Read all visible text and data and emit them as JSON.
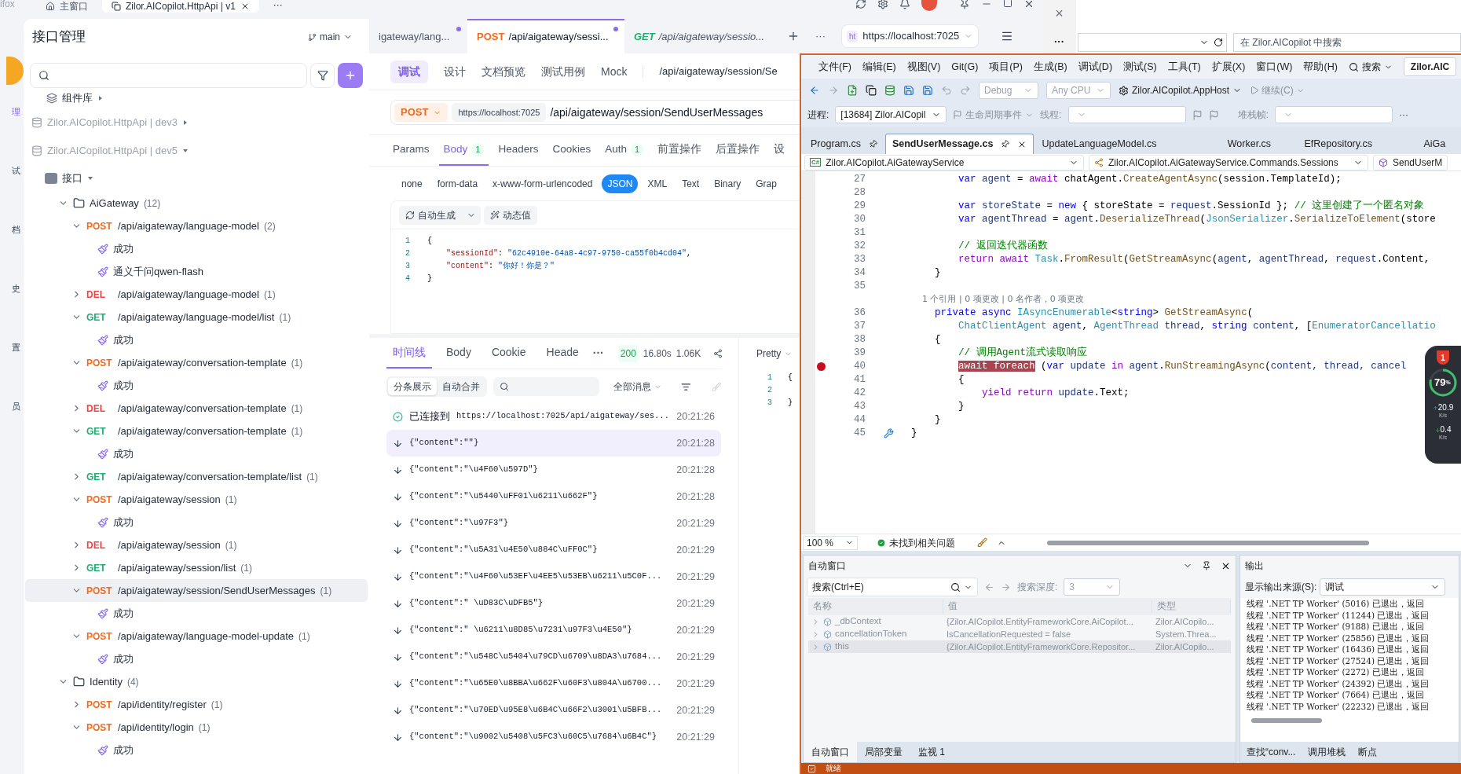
{
  "explorer": {
    "close": "×",
    "more": "···",
    "search_placeholder": "在 Zilor.AICopilot 中搜索"
  },
  "apifox": {
    "titlebar": {
      "app_name": "ifox",
      "tabs": [
        {
          "label": "主窗口",
          "selected": false
        },
        {
          "label": "Zilor.AICopilot.HttpApi | v1",
          "selected": true
        }
      ],
      "more": "···"
    },
    "nav": [
      {
        "label": "理",
        "selected": true
      },
      {
        "label": "试",
        "selected": false
      },
      {
        "label": "档",
        "selected": false
      },
      {
        "label": "史",
        "selected": false
      },
      {
        "label": "置",
        "selected": false
      },
      {
        "label": "员",
        "selected": false
      }
    ],
    "panel": {
      "title": "接口管理",
      "branch": "main"
    },
    "tree": [
      {
        "kind": "library",
        "label": "组件库",
        "expanded": false
      },
      {
        "kind": "project",
        "label": "Zilor.AICopilot.HttpApi | dev3",
        "expanded": false
      },
      {
        "kind": "project",
        "label": "Zilor.AICopilot.HttpApi | dev5",
        "expanded": true,
        "children": [
          {
            "kind": "root",
            "label": "接口",
            "expanded": true,
            "children": [
              {
                "kind": "folder",
                "label": "AiGateway",
                "count": "(12)",
                "expanded": true,
                "children": [
                  {
                    "kind": "endpoint",
                    "method": "POST",
                    "color": "#f26b1d",
                    "path": "/api/aigateway/language-model",
                    "count": "(2)",
                    "expanded": true,
                    "selected": false,
                    "children": [
                      {
                        "kind": "case",
                        "label": "成功",
                        "selected": false
                      },
                      {
                        "kind": "case",
                        "label": "通义千问qwen-flash",
                        "selected": false
                      }
                    ]
                  },
                  {
                    "kind": "endpoint",
                    "method": "DEL",
                    "color": "#ef4444",
                    "path": "/api/aigateway/language-model",
                    "count": "(1)",
                    "expanded": false,
                    "selected": false
                  },
                  {
                    "kind": "endpoint",
                    "method": "GET",
                    "color": "#1fae72",
                    "path": "/api/aigateway/language-model/list",
                    "count": "(1)",
                    "expanded": true,
                    "selected": false,
                    "children": [
                      {
                        "kind": "case",
                        "label": "成功",
                        "selected": false
                      }
                    ]
                  },
                  {
                    "kind": "endpoint",
                    "method": "POST",
                    "color": "#f26b1d",
                    "path": "/api/aigateway/conversation-template",
                    "count": "(1)",
                    "expanded": true,
                    "selected": false,
                    "children": [
                      {
                        "kind": "case",
                        "label": "成功",
                        "selected": false
                      }
                    ]
                  },
                  {
                    "kind": "endpoint",
                    "method": "DEL",
                    "color": "#ef4444",
                    "path": "/api/aigateway/conversation-template",
                    "count": "(1)",
                    "expanded": false,
                    "selected": false
                  },
                  {
                    "kind": "endpoint",
                    "method": "GET",
                    "color": "#1fae72",
                    "path": "/api/aigateway/conversation-template",
                    "count": "(1)",
                    "expanded": true,
                    "selected": false,
                    "children": [
                      {
                        "kind": "case",
                        "label": "成功",
                        "selected": false
                      }
                    ]
                  },
                  {
                    "kind": "endpoint",
                    "method": "GET",
                    "color": "#1fae72",
                    "path": "/api/aigateway/conversation-template/list",
                    "count": "(1)",
                    "expanded": false,
                    "selected": false
                  },
                  {
                    "kind": "endpoint",
                    "method": "POST",
                    "color": "#f26b1d",
                    "path": "/api/aigateway/session",
                    "count": "(1)",
                    "expanded": true,
                    "selected": false,
                    "children": [
                      {
                        "kind": "case",
                        "label": "成功",
                        "selected": false
                      }
                    ]
                  },
                  {
                    "kind": "endpoint",
                    "method": "DEL",
                    "color": "#ef4444",
                    "path": "/api/aigateway/session",
                    "count": "(1)",
                    "expanded": false,
                    "selected": false
                  },
                  {
                    "kind": "endpoint",
                    "method": "GET",
                    "color": "#1fae72",
                    "path": "/api/aigateway/session/list",
                    "count": "(1)",
                    "expanded": false,
                    "selected": false
                  },
                  {
                    "kind": "endpoint",
                    "method": "POST",
                    "color": "#f26b1d",
                    "path": "/api/aigateway/session/SendUserMessages",
                    "count": "(1)",
                    "expanded": true,
                    "selected": true,
                    "children": [
                      {
                        "kind": "case",
                        "label": "成功",
                        "selected": false
                      }
                    ]
                  },
                  {
                    "kind": "endpoint",
                    "method": "POST",
                    "color": "#f26b1d",
                    "path": "/api/aigateway/language-model-update",
                    "count": "(1)",
                    "expanded": true,
                    "selected": false,
                    "children": [
                      {
                        "kind": "case",
                        "label": "成功",
                        "selected": false
                      }
                    ]
                  }
                ]
              },
              {
                "kind": "folder",
                "label": "Identity",
                "count": "(4)",
                "expanded": true,
                "children": [
                  {
                    "kind": "endpoint",
                    "method": "POST",
                    "color": "#f26b1d",
                    "path": "/api/identity/register",
                    "count": "(1)",
                    "expanded": false,
                    "selected": false
                  },
                  {
                    "kind": "endpoint",
                    "method": "POST",
                    "color": "#f26b1d",
                    "path": "/api/identity/login",
                    "count": "(1)",
                    "expanded": true,
                    "selected": false,
                    "children": [
                      {
                        "kind": "case",
                        "label": "成功",
                        "selected": false
                      }
                    ]
                  }
                ]
              }
            ]
          }
        ]
      }
    ],
    "request_tabs": [
      {
        "label": "igateway/lang...",
        "dirty": true,
        "selected": false
      },
      {
        "method": "POST",
        "color": "#f26b1d",
        "label": "/api/aigateway/sessi...",
        "dirty": true,
        "selected": true
      },
      {
        "method": "GET",
        "color": "#1fae72",
        "label": "/api/aigateway/sessio...",
        "dirty": false,
        "selected": false
      }
    ],
    "tab_more": "···",
    "env": {
      "badge": "ht",
      "url": "https://localhost:7025"
    },
    "mode_tabs": [
      {
        "label": "调试",
        "selected": true
      },
      {
        "label": "设计",
        "selected": false
      },
      {
        "label": "文档预览",
        "selected": false
      },
      {
        "label": "测试用例",
        "selected": false
      },
      {
        "label": "Mock",
        "selected": false
      }
    ],
    "path_title": "/api/aigateway/session/Se",
    "request": {
      "method": "POST",
      "color": "#f26b1d",
      "base_url": "https://localhost:7025",
      "path": "/api/aigateway/session/SendUserMessages"
    },
    "param_tabs": [
      {
        "label": "Params",
        "selected": false
      },
      {
        "label": "Body",
        "count": "1",
        "selected": true
      },
      {
        "label": "Headers",
        "selected": false
      },
      {
        "label": "Cookies",
        "selected": false
      },
      {
        "label": "Auth",
        "count": "1",
        "selected": false
      },
      {
        "label": "前置操作",
        "selected": false
      },
      {
        "label": "后置操作",
        "selected": false
      },
      {
        "label": "设",
        "selected": false
      }
    ],
    "body_types": [
      {
        "label": "none",
        "selected": false
      },
      {
        "label": "form-data",
        "selected": false
      },
      {
        "label": "x-www-form-urlencoded",
        "selected": false
      },
      {
        "label": "JSON",
        "selected": true
      },
      {
        "label": "XML",
        "selected": false
      },
      {
        "label": "Text",
        "selected": false
      },
      {
        "label": "Binary",
        "selected": false
      },
      {
        "label": "Grap",
        "selected": false
      }
    ],
    "editor_tools": {
      "generate": "自动生成",
      "dynamic": "动态值"
    },
    "body_lines": [
      {
        "number": "1",
        "tokens": [
          {
            "kind": "punct",
            "text": "{"
          }
        ]
      },
      {
        "number": "2",
        "tokens": [
          {
            "kind": "key",
            "text": "    \"sessionId\""
          },
          {
            "kind": "punct",
            "text": ": "
          },
          {
            "kind": "string",
            "text": "\"62c4910e-64a8-4c97-9750-ca55f0b4cd04\""
          },
          {
            "kind": "punct",
            "text": ","
          }
        ]
      },
      {
        "number": "3",
        "tokens": [
          {
            "kind": "key",
            "text": "    \"content\""
          },
          {
            "kind": "punct",
            "text": ": "
          },
          {
            "kind": "string",
            "text": "\"你好！你是？\""
          }
        ]
      },
      {
        "number": "4",
        "tokens": [
          {
            "kind": "punct",
            "text": "}"
          }
        ]
      }
    ],
    "response": {
      "tabs": [
        {
          "label": "时间线",
          "selected": true
        },
        {
          "label": "Body",
          "selected": false
        },
        {
          "label": "Cookie",
          "selected": false
        },
        {
          "label": "Heade",
          "selected": false
        }
      ],
      "more": "···",
      "status": "200",
      "duration": "16.80s",
      "size": "1.06K",
      "view": "Pretty",
      "preview_lines": [
        {
          "number": "1",
          "text": "{"
        },
        {
          "number": "2"
        },
        {
          "number": "3",
          "text": "}"
        }
      ],
      "modes": [
        {
          "label": "分条展示",
          "selected": true
        },
        {
          "label": "自动合并",
          "selected": false
        }
      ],
      "filter": "全部消息",
      "timeline": [
        {
          "kind": "connected",
          "label": "已连接到",
          "text": "https://localhost:7025/api/aigateway/ses...",
          "time": "20:21:26",
          "selected": false
        },
        {
          "kind": "message",
          "text": "{\"content\":\"\"}",
          "time": "20:21:28",
          "selected": true
        },
        {
          "kind": "message",
          "text": "{\"content\":\"\\u4F60\\u597D\"}",
          "time": "20:21:28",
          "selected": false
        },
        {
          "kind": "message",
          "text": "{\"content\":\"\\u5440\\uFF01\\u6211\\u662F\"}",
          "time": "20:21:28",
          "selected": false
        },
        {
          "kind": "message",
          "text": "{\"content\":\"\\u97F3\"}",
          "time": "20:21:29",
          "selected": false
        },
        {
          "kind": "message",
          "text": "{\"content\":\"\\u5A31\\u4E50\\u884C\\uFF0C\"}",
          "time": "20:21:29",
          "selected": false
        },
        {
          "kind": "message",
          "text": "{\"content\":\"\\u4F60\\u53EF\\u4EE5\\u53EB\\u6211\\u5C0F...",
          "time": "20:21:29",
          "selected": false
        },
        {
          "kind": "message",
          "text": "{\"content\":\" \\uD83C\\uDFB5\"}",
          "time": "20:21:29",
          "selected": false
        },
        {
          "kind": "message",
          "text": "{\"content\":\" \\u6211\\u8D85\\u7231\\u97F3\\u4E50\"}",
          "time": "20:21:29",
          "selected": false
        },
        {
          "kind": "message",
          "text": "{\"content\":\"\\u548C\\u5404\\u79CD\\u6709\\u8DA3\\u7684...",
          "time": "20:21:29",
          "selected": false
        },
        {
          "kind": "message",
          "text": "{\"content\":\"\\u65E0\\u8BBA\\u662F\\u60F3\\u804A\\u6700...",
          "time": "20:21:29",
          "selected": false
        },
        {
          "kind": "message",
          "text": "{\"content\":\"\\u70ED\\u95E8\\u6B4C\\u66F2\\u3001\\u5BFB...",
          "time": "20:21:29",
          "selected": false
        },
        {
          "kind": "message",
          "text": "{\"content\":\"\\u9002\\u5408\\u5FC3\\u60C5\\u7684\\u6B4C\"}",
          "time": "20:21:29",
          "selected": false
        }
      ]
    }
  },
  "vs": {
    "menu": [
      "文件(F)",
      "编辑(E)",
      "视图(V)",
      "Git(G)",
      "项目(P)",
      "生成(B)",
      "调试(D)",
      "测试(S)",
      "工具(T)",
      "扩展(X)",
      "窗口(W)",
      "帮助(H)"
    ],
    "search": "搜索",
    "title": "Zilor.AIC",
    "toolbar": {
      "config": "Debug",
      "platform": "Any CPU",
      "startup": "Zilor.AICopilot.AppHost",
      "continue": "继续(C)"
    },
    "debug_bar": {
      "process_label": "进程:",
      "process": "[13684] Zilor.AICopil",
      "lifecycle": "生命周期事件",
      "thread_label": "线程:",
      "stack_label": "堆栈帧:",
      "more": "···"
    },
    "doc_tabs": [
      {
        "label": "Program.cs",
        "pinned": true,
        "selected": false
      },
      {
        "label": "SendUserMessage.cs",
        "pinned": true,
        "selected": true
      },
      {
        "label": "UpdateLanguageModel.cs",
        "pinned": false,
        "selected": false
      },
      {
        "label": "Worker.cs",
        "pinned": false,
        "selected": false
      },
      {
        "label": "EfRepository.cs",
        "pinned": false,
        "selected": false
      },
      {
        "label": "AiGa",
        "pinned": false,
        "selected": false
      }
    ],
    "nav": [
      {
        "badge": "C#",
        "text": "Zilor.AICopilot.AiGatewayService"
      },
      {
        "text": "Zilor.AICopilot.AiGatewayService.Commands.Sessions"
      },
      {
        "text": "SendUserM"
      }
    ],
    "code": [
      {
        "kind": "line",
        "number": "27",
        "tokens": [
          {
            "kind": "kw",
            "text": "        var"
          },
          {
            "kind": "local",
            "text": " agent"
          },
          {
            "kind": "plain",
            "text": " = "
          },
          {
            "kind": "ctrl",
            "text": "await"
          },
          {
            "kind": "plain",
            "text": " chatAgent."
          },
          {
            "kind": "method",
            "text": "CreateAgentAsync"
          },
          {
            "kind": "plain",
            "text": "(session.TemplateId);"
          }
        ]
      },
      {
        "kind": "line",
        "number": "28"
      },
      {
        "kind": "line",
        "number": "29",
        "tokens": [
          {
            "kind": "kw",
            "text": "        var"
          },
          {
            "kind": "local",
            "text": " storeState"
          },
          {
            "kind": "plain",
            "text": " = "
          },
          {
            "kind": "kw",
            "text": "new"
          },
          {
            "kind": "plain",
            "text": " { storeState = "
          },
          {
            "kind": "local",
            "text": "request"
          },
          {
            "kind": "plain",
            "text": ".SessionId }; "
          },
          {
            "kind": "comment",
            "text": "// 这里创建了一个匿名对象"
          }
        ]
      },
      {
        "kind": "line",
        "number": "30",
        "tokens": [
          {
            "kind": "kw",
            "text": "        var"
          },
          {
            "kind": "local",
            "text": " agentThread"
          },
          {
            "kind": "plain",
            "text": " = "
          },
          {
            "kind": "local",
            "text": "agent"
          },
          {
            "kind": "plain",
            "text": "."
          },
          {
            "kind": "method",
            "text": "DeserializeThread"
          },
          {
            "kind": "plain",
            "text": "("
          },
          {
            "kind": "type",
            "text": "JsonSerializer"
          },
          {
            "kind": "plain",
            "text": "."
          },
          {
            "kind": "method",
            "text": "SerializeToElement"
          },
          {
            "kind": "plain",
            "text": "(store"
          }
        ]
      },
      {
        "kind": "line",
        "number": "31"
      },
      {
        "kind": "line",
        "number": "32",
        "tokens": [
          {
            "kind": "comment",
            "text": "        // 返回迭代器函数"
          }
        ]
      },
      {
        "kind": "line",
        "number": "33",
        "tokens": [
          {
            "kind": "ctrl",
            "text": "        return await"
          },
          {
            "kind": "type",
            "text": " Task"
          },
          {
            "kind": "plain",
            "text": "."
          },
          {
            "kind": "method",
            "text": "FromResult"
          },
          {
            "kind": "plain",
            "text": "("
          },
          {
            "kind": "method",
            "text": "GetStreamAsync"
          },
          {
            "kind": "plain",
            "text": "("
          },
          {
            "kind": "local",
            "text": "agent"
          },
          {
            "kind": "plain",
            "text": ", "
          },
          {
            "kind": "local",
            "text": "agentThread"
          },
          {
            "kind": "plain",
            "text": ", "
          },
          {
            "kind": "local",
            "text": "request"
          },
          {
            "kind": "plain",
            "text": ".Content,"
          }
        ]
      },
      {
        "kind": "line",
        "number": "34",
        "tokens": [
          {
            "kind": "plain",
            "text": "    }"
          }
        ]
      },
      {
        "kind": "line",
        "number": "35"
      },
      {
        "kind": "lens",
        "text": "    1 个引用 | 0 项更改 | 0 名作者，0 项更改"
      },
      {
        "kind": "line",
        "number": "36",
        "tokens": [
          {
            "kind": "kw",
            "text": "    private async"
          },
          {
            "kind": "type",
            "text": " IAsyncEnumerable"
          },
          {
            "kind": "plain",
            "text": "<"
          },
          {
            "kind": "kw",
            "text": "string"
          },
          {
            "kind": "plain",
            "text": "> "
          },
          {
            "kind": "method",
            "text": "GetStreamAsync"
          },
          {
            "kind": "plain",
            "text": "("
          }
        ]
      },
      {
        "kind": "line",
        "number": "37",
        "tokens": [
          {
            "kind": "type",
            "text": "        ChatClientAgent"
          },
          {
            "kind": "local",
            "text": " agent"
          },
          {
            "kind": "plain",
            "text": ", "
          },
          {
            "kind": "type",
            "text": "AgentThread"
          },
          {
            "kind": "local",
            "text": " thread"
          },
          {
            "kind": "plain",
            "text": ", "
          },
          {
            "kind": "kw",
            "text": "string"
          },
          {
            "kind": "local",
            "text": " content"
          },
          {
            "kind": "plain",
            "text": ", ["
          },
          {
            "kind": "type",
            "text": "EnumeratorCancellatio"
          }
        ]
      },
      {
        "kind": "line",
        "number": "38",
        "tokens": [
          {
            "kind": "plain",
            "text": "    {"
          }
        ]
      },
      {
        "kind": "line",
        "number": "39",
        "tokens": [
          {
            "kind": "comment",
            "text": "        // 调用Agent流式读取响应"
          }
        ]
      },
      {
        "kind": "line",
        "number": "40",
        "breakpoint": true,
        "tokens": [
          {
            "kind": "current",
            "text": "        await foreach"
          },
          {
            "kind": "plain",
            "text": " ("
          },
          {
            "kind": "kw",
            "text": "var"
          },
          {
            "kind": "local",
            "text": " update"
          },
          {
            "kind": "ctrl",
            "text": " in"
          },
          {
            "kind": "local",
            "text": " agent"
          },
          {
            "kind": "plain",
            "text": "."
          },
          {
            "kind": "method",
            "text": "RunStreamingAsync"
          },
          {
            "kind": "plain",
            "text": "("
          },
          {
            "kind": "local",
            "text": "content, thread, cancel"
          }
        ]
      },
      {
        "kind": "line",
        "number": "41",
        "tokens": [
          {
            "kind": "plain",
            "text": "        {"
          }
        ]
      },
      {
        "kind": "line",
        "number": "42",
        "tokens": [
          {
            "kind": "ctrl",
            "text": "            yield return"
          },
          {
            "kind": "local",
            "text": " update"
          },
          {
            "kind": "plain",
            "text": ".Text;"
          }
        ]
      },
      {
        "kind": "line",
        "number": "43",
        "tokens": [
          {
            "kind": "plain",
            "text": "        }"
          }
        ]
      },
      {
        "kind": "line",
        "number": "44",
        "tokens": [
          {
            "kind": "plain",
            "text": "    }"
          }
        ]
      },
      {
        "kind": "line",
        "number": "45",
        "quick_action": true,
        "tokens": [
          {
            "kind": "plain",
            "text": "}"
          }
        ]
      }
    ],
    "status": {
      "zoom": "100 %",
      "issues": "未找到相关问题"
    },
    "monitor": {
      "alerts": "1",
      "cpu": "79",
      "cpu_unit": "%",
      "up": "20.9",
      "up_unit": "K/s",
      "down": "0.4",
      "down_unit": "K/s"
    },
    "autos": {
      "title": "自动窗口",
      "search_placeholder": "搜索(Ctrl+E)",
      "depth_label": "搜索深度:",
      "depth": "3",
      "columns": [
        "名称",
        "值",
        "类型"
      ],
      "rows": [
        {
          "name": "_dbContext",
          "value": "{Zilor.AICopilot.EntityFrameworkCore.AiCopilot...",
          "type": "Zilor.AICopilo...",
          "selected": false
        },
        {
          "name": "cancellationToken",
          "value": "IsCancellationRequested = false",
          "type": "System.Threa...",
          "selected": false
        },
        {
          "name": "this",
          "value": "{Zilor.AICopilot.EntityFrameworkCore.Repositor...",
          "type": "Zilor.AICopilo...",
          "selected": true
        }
      ],
      "tabs": [
        {
          "label": "自动窗口",
          "selected": true
        },
        {
          "label": "局部变量",
          "selected": false
        },
        {
          "label": "监视 1",
          "selected": false
        }
      ]
    },
    "output": {
      "title": "输出",
      "source_label": "显示输出来源(S):",
      "source": "调试",
      "lines": [
        "线程 '.NET TP Worker' (5016) 已退出，返回",
        "线程 '.NET TP Worker' (11244) 已退出，返回",
        "线程 '.NET TP Worker' (9188) 已退出，返回",
        "线程 '.NET TP Worker' (25856) 已退出，返回",
        "线程 '.NET TP Worker' (16436) 已退出，返回",
        "线程 '.NET TP Worker' (27524) 已退出，返回",
        "线程 '.NET TP Worker' (2272) 已退出，返回",
        "线程 '.NET TP Worker' (24392) 已退出，返回",
        "线程 '.NET TP Worker' (7664) 已退出，返回",
        "线程 '.NET TP Worker' (22232) 已退出，返回"
      ],
      "tabs": [
        {
          "label": "查找“conv...",
          "selected": false
        },
        {
          "label": "调用堆栈",
          "selected": false
        },
        {
          "label": "断点",
          "selected": false
        }
      ]
    },
    "statusbar": {
      "text": "就绪"
    }
  }
}
